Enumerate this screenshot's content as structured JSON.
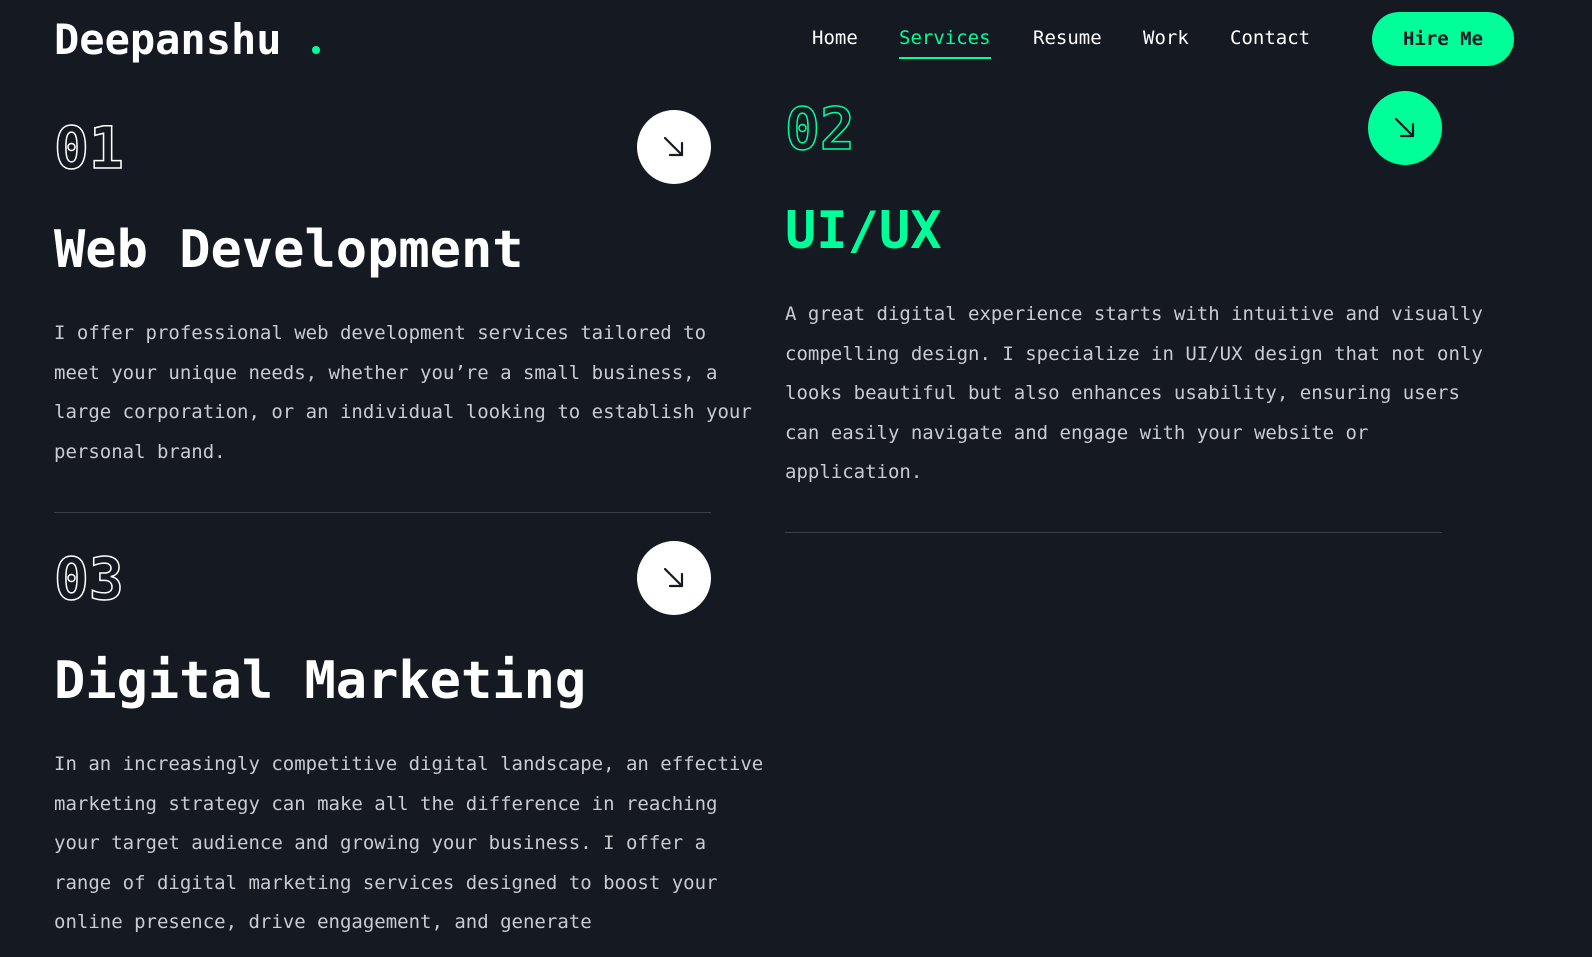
{
  "header": {
    "logo": "Deepanshu",
    "nav": [
      {
        "label": "Home",
        "active": false
      },
      {
        "label": "Services",
        "active": true
      },
      {
        "label": "Resume",
        "active": false
      },
      {
        "label": "Work",
        "active": false
      },
      {
        "label": "Contact",
        "active": false
      }
    ],
    "cta_label": "Hire Me"
  },
  "colors": {
    "background": "#151922",
    "accent": "#00ff99",
    "text": "#ffffff",
    "muted_text": "#c9cbd1"
  },
  "services": [
    {
      "number": "01",
      "title": "Web Development",
      "description": "I offer professional web development services tailored to meet your unique needs, whether you’re a small business, a large corporation, or an individual looking to establish your personal brand.",
      "icon": "arrow-down-right-icon",
      "highlighted": false
    },
    {
      "number": "02",
      "title": "UI/UX",
      "description": "A great digital experience starts with intuitive and visually compelling design. I specialize in UI/UX design that not only looks beautiful but also enhances usability, ensuring users can easily navigate and engage with your website or application.",
      "icon": "arrow-down-right-icon",
      "highlighted": true
    },
    {
      "number": "03",
      "title": "Digital Marketing",
      "description": "In an increasingly competitive digital landscape, an effective marketing strategy can make all the difference in reaching your target audience and growing your business. I offer a range of digital marketing services designed to boost your online presence, drive engagement, and generate",
      "icon": "arrow-down-right-icon",
      "highlighted": false
    }
  ]
}
